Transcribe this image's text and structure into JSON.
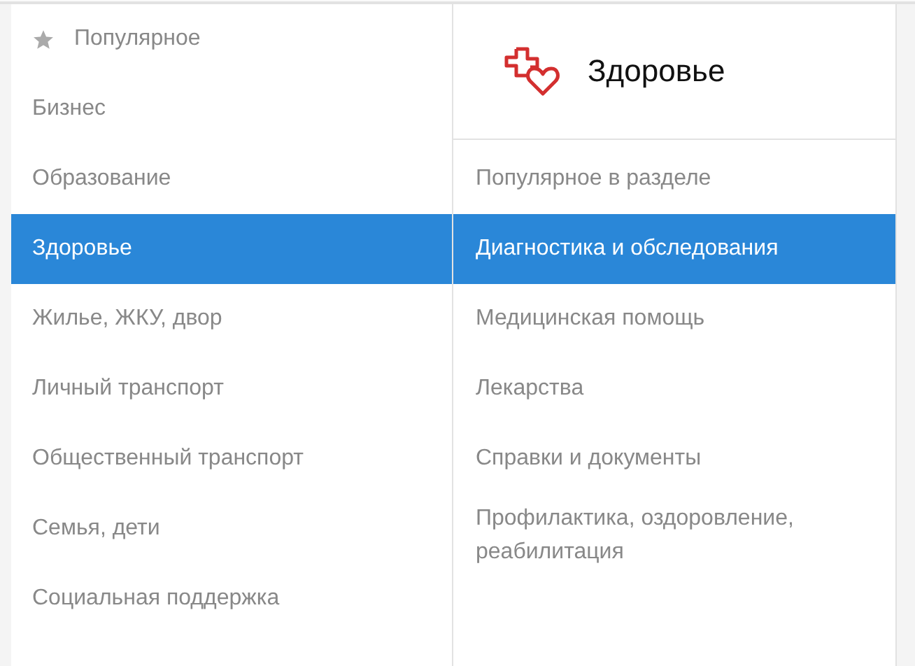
{
  "categories": [
    {
      "label": "Популярное",
      "selected": false,
      "kind": "starred"
    },
    {
      "label": "Бизнес",
      "selected": false,
      "kind": "plain"
    },
    {
      "label": "Образование",
      "selected": false,
      "kind": "plain"
    },
    {
      "label": "Здоровье",
      "selected": true,
      "kind": "plain"
    },
    {
      "label": "Жилье, ЖКУ, двор",
      "selected": false,
      "kind": "plain"
    },
    {
      "label": "Личный транспорт",
      "selected": false,
      "kind": "plain"
    },
    {
      "label": "Общественный транспорт",
      "selected": false,
      "kind": "plain"
    },
    {
      "label": "Семья, дети",
      "selected": false,
      "kind": "plain"
    },
    {
      "label": "Социальная поддержка",
      "selected": false,
      "kind": "plain"
    }
  ],
  "section": {
    "title": "Здоровье",
    "items": [
      {
        "label": "Популярное в разделе",
        "selected": false
      },
      {
        "label": "Диагностика и обследования",
        "selected": true
      },
      {
        "label": "Медицинская помощь",
        "selected": false
      },
      {
        "label": "Лекарства",
        "selected": false
      },
      {
        "label": "Справки и документы",
        "selected": false
      },
      {
        "label": "Профилактика, оздоровление, реабилитация",
        "selected": false
      }
    ]
  }
}
